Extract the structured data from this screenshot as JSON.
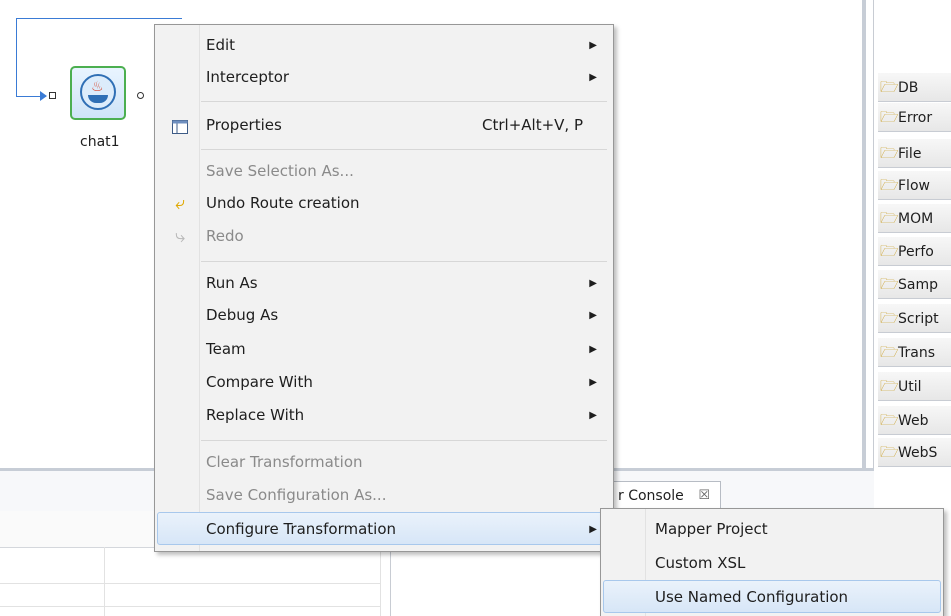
{
  "canvas": {
    "node_label": "chat1"
  },
  "palette": {
    "items": [
      {
        "label": "DB"
      },
      {
        "label": "Error"
      },
      {
        "label": "File"
      },
      {
        "label": "Flow"
      },
      {
        "label": "MOM"
      },
      {
        "label": "Perfo"
      },
      {
        "label": "Samp"
      },
      {
        "label": "Script"
      },
      {
        "label": "Trans"
      },
      {
        "label": "Util"
      },
      {
        "label": "Web"
      },
      {
        "label": "WebS"
      }
    ]
  },
  "console": {
    "tab_label": "r Console",
    "tab_close": "☒"
  },
  "context_menu": {
    "items": [
      {
        "label": "Edit",
        "submenu_arrow": "▶"
      },
      {
        "label": "Interceptor",
        "submenu_arrow": "▶"
      },
      {
        "label": "Properties",
        "shortcut": "Ctrl+Alt+V, P",
        "icon": "properties-icon"
      },
      {
        "label": "Save Selection As..."
      },
      {
        "label": "Undo Route creation",
        "icon": "undo-icon"
      },
      {
        "label": "Redo",
        "icon": "redo-icon"
      },
      {
        "label": "Run As",
        "submenu_arrow": "▶"
      },
      {
        "label": "Debug As",
        "submenu_arrow": "▶"
      },
      {
        "label": "Team",
        "submenu_arrow": "▶"
      },
      {
        "label": "Compare With",
        "submenu_arrow": "▶"
      },
      {
        "label": "Replace With",
        "submenu_arrow": "▶"
      },
      {
        "label": "Clear Transformation"
      },
      {
        "label": "Save Configuration As..."
      },
      {
        "label": "Configure Transformation",
        "submenu_arrow": "▶"
      }
    ]
  },
  "submenu": {
    "items": [
      {
        "label": "Mapper Project"
      },
      {
        "label": "Custom XSL"
      },
      {
        "label": "Use Named Configuration"
      }
    ]
  },
  "colors": {
    "selection_bg": "#dbe8f8",
    "route_line": "#3a7bd5",
    "node_border": "#4caf50"
  }
}
